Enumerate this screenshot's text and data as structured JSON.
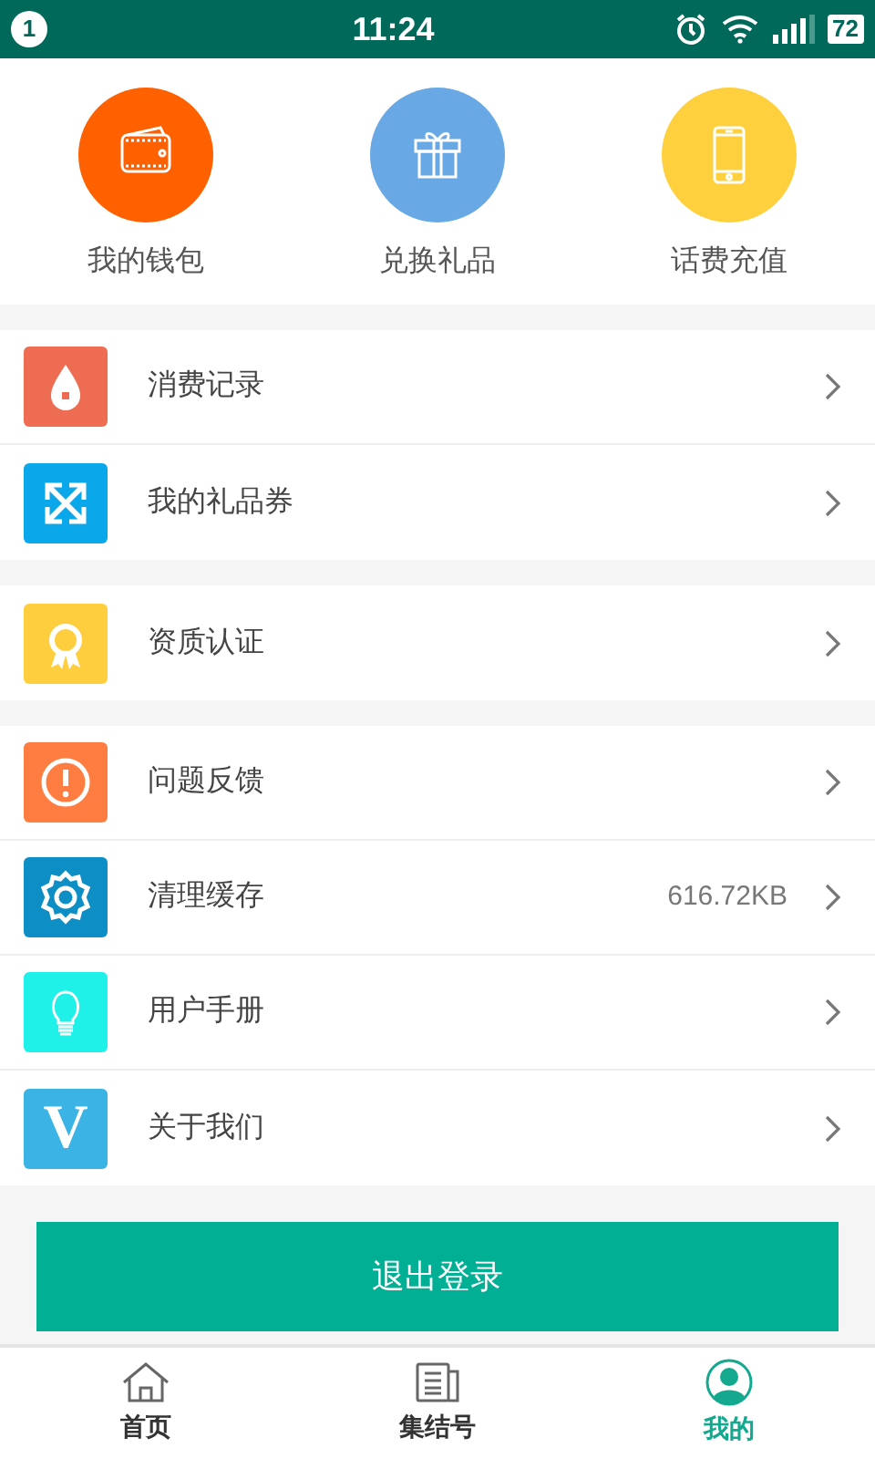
{
  "status_bar": {
    "notification_count": "1",
    "time": "11:24",
    "battery": "72"
  },
  "shortcuts": [
    {
      "label": "我的钱包"
    },
    {
      "label": "兑换礼品"
    },
    {
      "label": "话费充值"
    }
  ],
  "menu_groups": [
    [
      {
        "label": "消费记录"
      },
      {
        "label": "我的礼品券"
      }
    ],
    [
      {
        "label": "资质认证"
      }
    ],
    [
      {
        "label": "问题反馈"
      },
      {
        "label": "清理缓存",
        "value": "616.72KB"
      },
      {
        "label": "用户手册"
      },
      {
        "label": "关于我们",
        "icon_letter": "V"
      }
    ]
  ],
  "logout_button": "退出登录",
  "bottom_nav": [
    {
      "label": "首页",
      "selected": false
    },
    {
      "label": "集结号",
      "selected": false
    },
    {
      "label": "我的",
      "selected": true
    }
  ]
}
